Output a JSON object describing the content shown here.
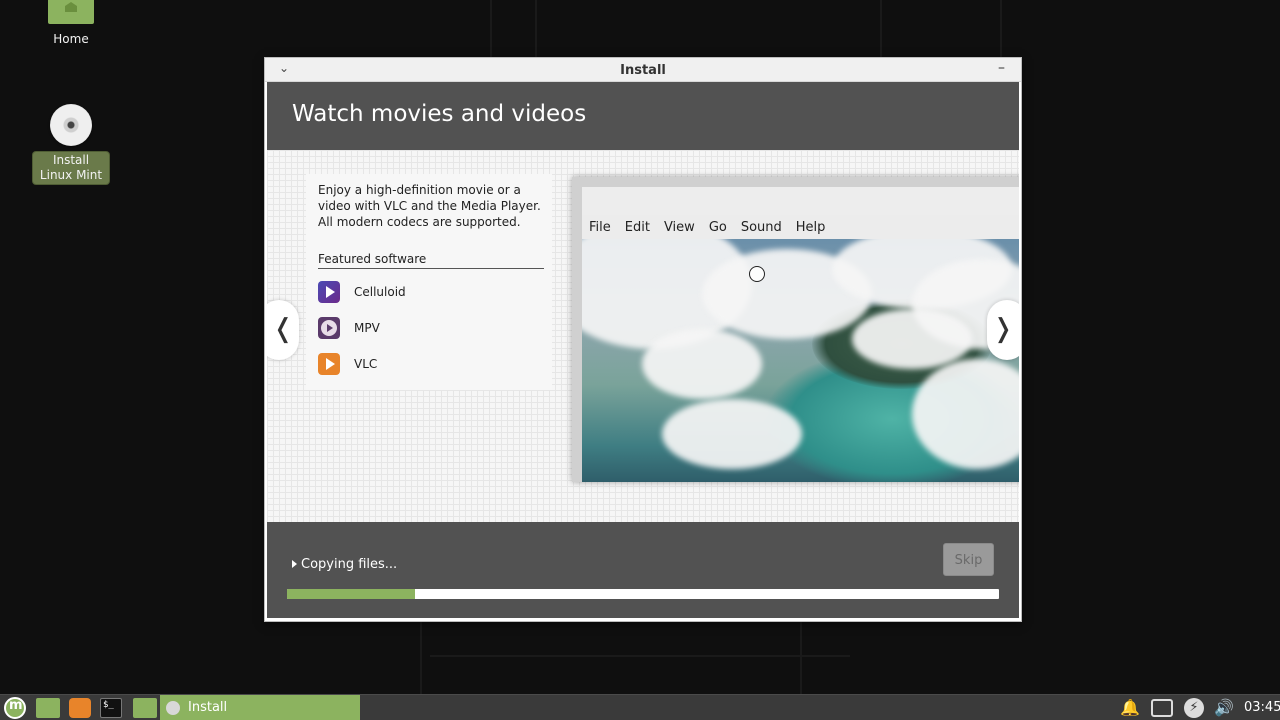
{
  "desktop": {
    "icons": [
      {
        "label": "Home"
      },
      {
        "label": "Install Linux Mint"
      }
    ]
  },
  "window": {
    "title": "Install",
    "heading": "Watch movies and videos",
    "description": "Enjoy a high-definition movie or a video with VLC and the Media Player. All modern codecs are supported.",
    "featured_label": "Featured software",
    "software": [
      {
        "name": "Celluloid",
        "icon": "celluloid-icon"
      },
      {
        "name": "MPV",
        "icon": "mpv-icon"
      },
      {
        "name": "VLC",
        "icon": "vlc-icon"
      }
    ],
    "preview_menu": [
      "File",
      "Edit",
      "View",
      "Go",
      "Sound",
      "Help"
    ],
    "nav_prev": "❬",
    "nav_next": "❭",
    "status_text": "Copying files...",
    "skip_label": "Skip",
    "progress": 0.18
  },
  "taskbar": {
    "active_task": "Install",
    "clock": "03:45"
  },
  "colors": {
    "accent": "#8cb35f",
    "band": "#525252"
  }
}
